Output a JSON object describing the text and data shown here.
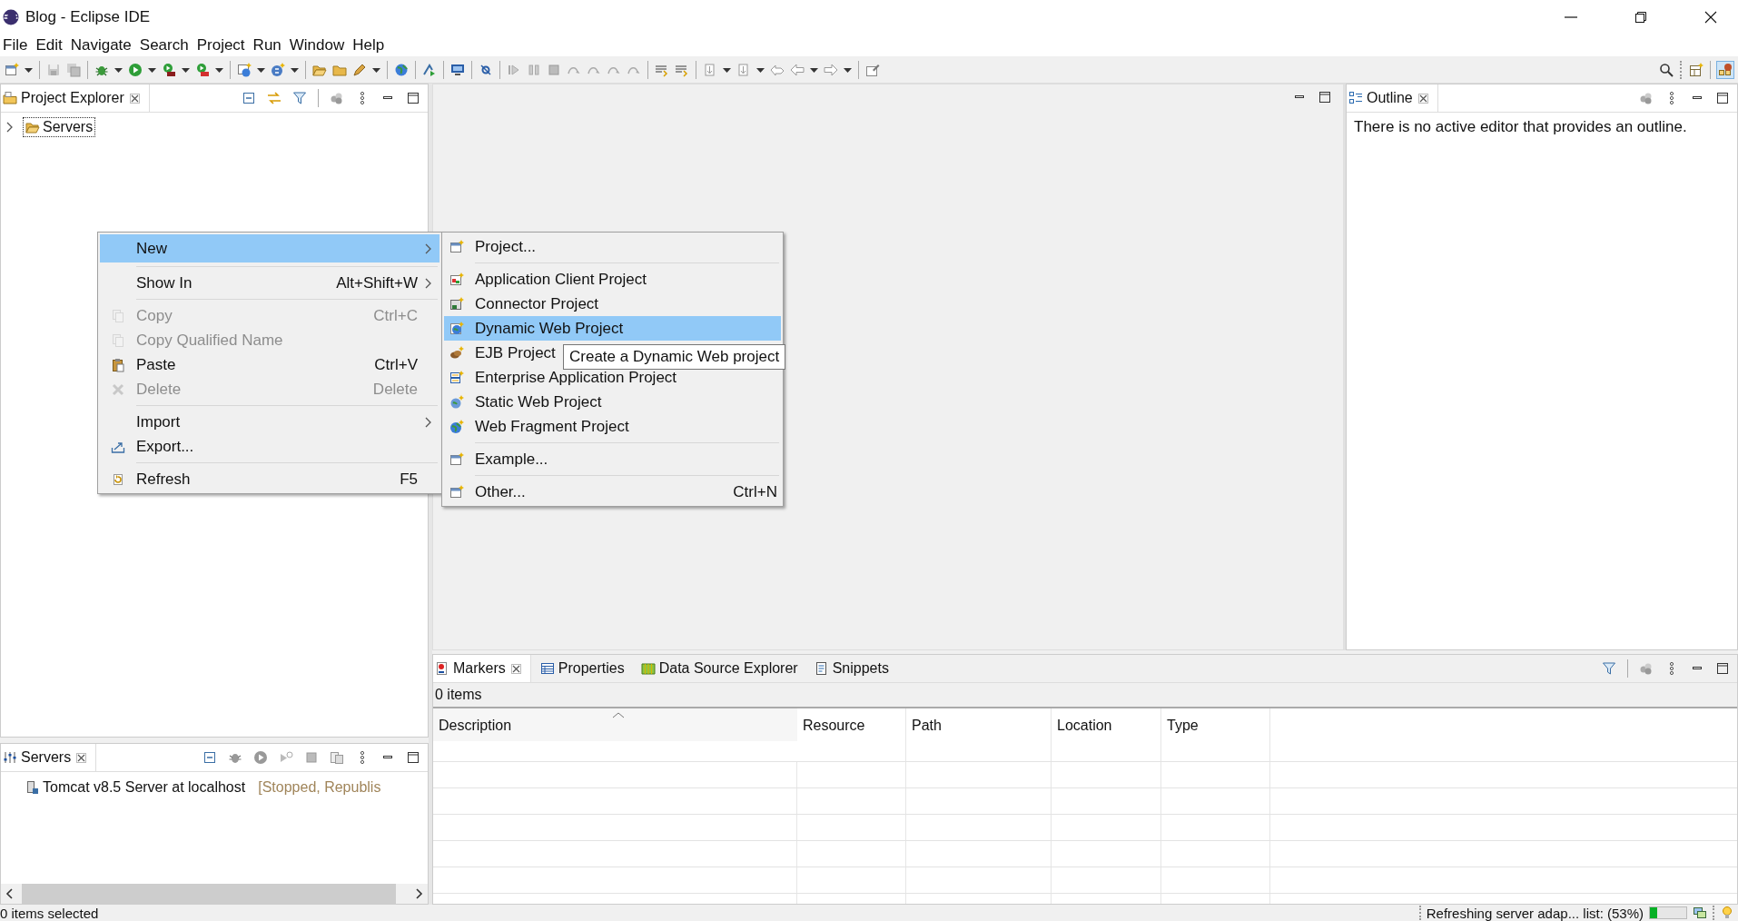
{
  "window": {
    "title": "Blog - Eclipse IDE"
  },
  "menu_bar": [
    "File",
    "Edit",
    "Navigate",
    "Search",
    "Project",
    "Run",
    "Window",
    "Help"
  ],
  "project_explorer": {
    "title": "Project Explorer",
    "tree": [
      {
        "label": "Servers",
        "expanded": false,
        "selected": true
      }
    ]
  },
  "servers_view": {
    "title": "Servers",
    "servers": [
      {
        "name": "Tomcat v8.5 Server at localhost",
        "status": "[Stopped, Republis"
      }
    ]
  },
  "context_menu": {
    "sections": [
      [
        {
          "label": "New",
          "submenu": true,
          "disabled": false,
          "selected": true
        }
      ],
      [
        {
          "label": "Show In",
          "shortcut": "Alt+Shift+W",
          "submenu": true,
          "disabled": false,
          "selected": false
        }
      ],
      [
        {
          "label": "Copy",
          "shortcut": "Ctrl+C",
          "submenu": false,
          "disabled": true,
          "selected": false
        },
        {
          "label": "Copy Qualified Name",
          "submenu": false,
          "disabled": true,
          "selected": false
        },
        {
          "label": "Paste",
          "shortcut": "Ctrl+V",
          "submenu": false,
          "disabled": false,
          "selected": false
        },
        {
          "label": "Delete",
          "shortcut": "Delete",
          "submenu": false,
          "disabled": true,
          "selected": false
        }
      ],
      [
        {
          "label": "Import",
          "submenu": true,
          "disabled": false,
          "selected": false
        },
        {
          "label": "Export...",
          "submenu": false,
          "disabled": false,
          "selected": false
        }
      ],
      [
        {
          "label": "Refresh",
          "shortcut": "F5",
          "submenu": false,
          "disabled": false,
          "selected": false
        }
      ]
    ]
  },
  "submenu": {
    "sections": [
      [
        {
          "label": "Project...",
          "selected": false
        }
      ],
      [
        {
          "label": "Application Client Project",
          "selected": false
        },
        {
          "label": "Connector Project",
          "selected": false
        },
        {
          "label": "Dynamic Web Project",
          "selected": true
        },
        {
          "label": "EJB Project",
          "selected": false
        },
        {
          "label": "Enterprise Application Project",
          "selected": false
        },
        {
          "label": "Static Web Project",
          "selected": false
        },
        {
          "label": "Web Fragment Project",
          "selected": false
        }
      ],
      [
        {
          "label": "Example...",
          "selected": false
        }
      ],
      [
        {
          "label": "Other...",
          "shortcut": "Ctrl+N",
          "selected": false
        }
      ]
    ]
  },
  "tooltip": "Create a Dynamic Web project",
  "outline": {
    "title": "Outline",
    "message": "There is no active editor that provides an outline."
  },
  "bottom_panel": {
    "tabs": [
      {
        "label": "Markers",
        "selected": true
      },
      {
        "label": "Properties",
        "selected": false
      },
      {
        "label": "Data Source Explorer",
        "selected": false
      },
      {
        "label": "Snippets",
        "selected": false
      }
    ],
    "count": "0 items",
    "columns": [
      "Description",
      "Resource",
      "Path",
      "Location",
      "Type"
    ]
  },
  "status_bar": {
    "left": "0 items selected",
    "task": "Refreshing server adap... list: (53%)",
    "level": 0.2
  }
}
